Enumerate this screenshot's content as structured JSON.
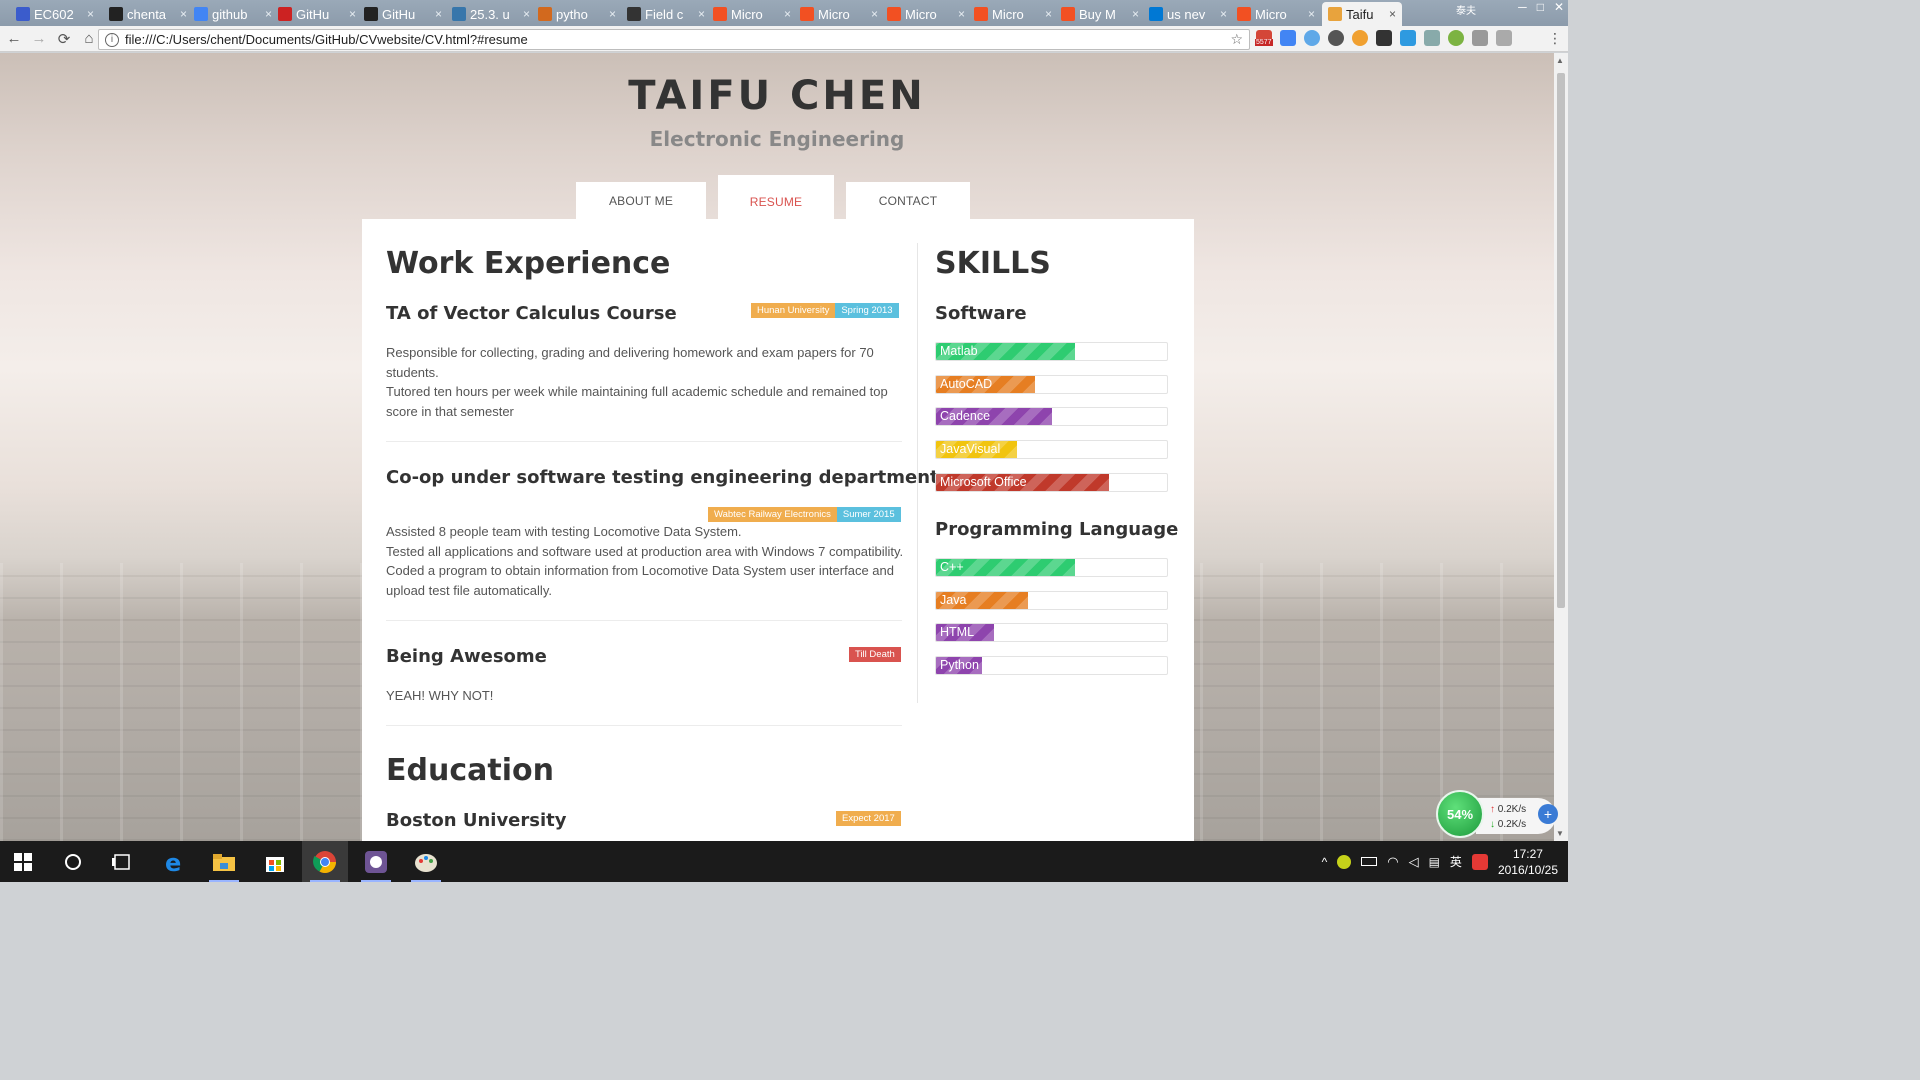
{
  "browser": {
    "tabs": [
      {
        "title": "EC602",
        "icon_color": "#3b5ccc"
      },
      {
        "title": "chenta",
        "icon_color": "#222222"
      },
      {
        "title": "github",
        "icon_color": "#4285f4"
      },
      {
        "title": "GitHu",
        "icon_color": "#cc2222"
      },
      {
        "title": "GitHu",
        "icon_color": "#222222"
      },
      {
        "title": "25.3. u",
        "icon_color": "#3776ab"
      },
      {
        "title": "pytho",
        "icon_color": "#d2691e"
      },
      {
        "title": "Field c",
        "icon_color": "#333333"
      },
      {
        "title": "Micro",
        "icon_color": "#f25022"
      },
      {
        "title": "Micro",
        "icon_color": "#f25022"
      },
      {
        "title": "Micro",
        "icon_color": "#f25022"
      },
      {
        "title": "Micro",
        "icon_color": "#f25022"
      },
      {
        "title": "Buy M",
        "icon_color": "#f25022"
      },
      {
        "title": "us nev",
        "icon_color": "#0078d4"
      },
      {
        "title": "Micro",
        "icon_color": "#f25022"
      },
      {
        "title": "Taifu",
        "icon_color": "#e8a33d",
        "active": true
      }
    ],
    "tab_close": "×",
    "window_user": "泰夫",
    "url": "file:///C:/Users/chent/Documents/GitHub/CVwebsite/CV.html?#resume",
    "info_icon": "i",
    "star_icon": "☆",
    "back_icon": "←",
    "forward_icon": "→",
    "reload_icon": "⟳",
    "home_icon": "⌂",
    "menu_icon": "⋮",
    "gmail_count": "5577",
    "window_controls": {
      "minimize": "─",
      "maximize": "□",
      "close": "✕"
    }
  },
  "page": {
    "name": "TAIFU CHEN",
    "subtitle": "Electronic Engineering",
    "nav": {
      "about": "ABOUT ME",
      "resume": "RESUME",
      "contact": "CONTACT"
    },
    "work": {
      "heading": "Work Experience",
      "jobs": [
        {
          "title": "TA of Vector Calculus Course",
          "org": "Hunan University",
          "date": "Spring 2013",
          "lines": [
            "Responsible for collecting, grading and delivering homework and exam papers for 70",
            "students.",
            "Tutored ten hours per week while maintaining full academic schedule and remained top",
            "score in that semester"
          ]
        },
        {
          "title": "Co-op under software testing engineering department",
          "org": "Wabtec Railway Electronics",
          "date": "Sumer 2015",
          "lines": [
            "Assisted 8 people team with testing Locomotive Data System.",
            "Tested all applications and software used at production area with Windows 7 compatibility.",
            "Coded a program to obtain information from Locomotive Data System user interface and",
            "upload test file automatically."
          ]
        },
        {
          "title": "Being Awesome",
          "date": "Till Death",
          "lines": [
            "YEAH! WHY NOT!"
          ]
        }
      ]
    },
    "education": {
      "heading": "Education",
      "schools": [
        {
          "name": "Boston University",
          "date": "Expect 2017"
        }
      ]
    },
    "skills": {
      "heading": "SKILLS",
      "software": {
        "heading": "Software",
        "items": [
          {
            "name": "Matlab",
            "level": 0.6,
            "color": "#2ecc71"
          },
          {
            "name": "AutoCAD",
            "level": 0.43,
            "color": "#e67e22"
          },
          {
            "name": "Cadence",
            "level": 0.5,
            "color": "#8e44ad"
          },
          {
            "name": "JavaVisual",
            "level": 0.35,
            "color": "#f1c40f"
          },
          {
            "name": "Microsoft Office",
            "level": 0.75,
            "color": "#c0392b"
          }
        ]
      },
      "programming": {
        "heading": "Programming Language",
        "items": [
          {
            "name": "C++",
            "level": 0.6,
            "color": "#2ecc71"
          },
          {
            "name": "Java",
            "level": 0.4,
            "color": "#e67e22"
          },
          {
            "name": "HTML",
            "level": 0.25,
            "color": "#8e44ad"
          },
          {
            "name": "Python",
            "level": 0.2,
            "color": "#8e44ad"
          }
        ]
      }
    }
  },
  "speed_widget": {
    "percent": "54%",
    "up": "0.2K/s",
    "down": "0.2K/s",
    "up_icon": "↑",
    "down_icon": "↓",
    "plus_icon": "+"
  },
  "taskbar": {
    "start_icon": "⊞",
    "search_icon": "○",
    "taskview_icon": "❐",
    "apps": [
      "edge",
      "file-explorer",
      "store",
      "chrome",
      "github-desktop",
      "paint"
    ],
    "tray": {
      "chevron": "^",
      "ime": "英",
      "action_center": "▤"
    },
    "time": "17:27",
    "date": "2016/10/25"
  }
}
